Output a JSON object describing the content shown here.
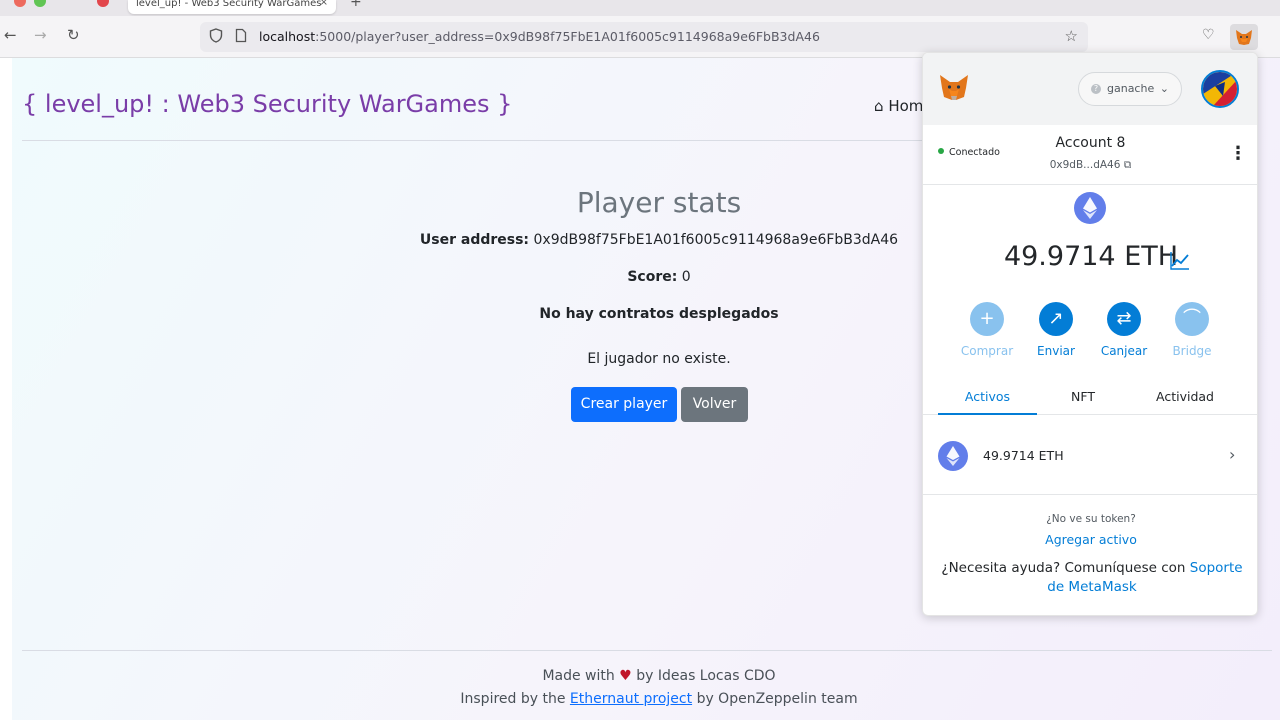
{
  "browser": {
    "tab_title": "level_up! - Web3 Security WarGames",
    "tab_close": "×",
    "new_tab": "+",
    "back_icon": "←",
    "forward_icon": "→",
    "reload_icon": "↻",
    "url_host": "localhost",
    "url_rest": ":5000/player?user_address=0x9dB98f75FbE1A01f6005c9114968a9e6FbB3dA46",
    "bookmark_icon": "☆",
    "pocket_icon": "♡"
  },
  "site": {
    "brand": "{ level_up! : Web3 Security WarGames }",
    "nav_home": "Hom",
    "home_icon": "⌂"
  },
  "player": {
    "title": "Player stats",
    "address_label": "User address:",
    "address_value": "0x9dB98f75FbE1A01f6005c9114968a9e6FbB3dA46",
    "score_label": "Score:",
    "score_value": "0",
    "no_contracts": "No hay contratos desplegados",
    "no_player": "El jugador no existe.",
    "create_button": "Crear player",
    "back_button": "Volver"
  },
  "footer": {
    "made_with_prefix": "Made with",
    "heart": "♥",
    "made_with_suffix": "by Ideas Locas CDO",
    "inspired_prefix": "Inspired by the",
    "ethernaut_link": "Ethernaut project",
    "inspired_suffix": "by OpenZeppelin team"
  },
  "metamask": {
    "network": "ganache",
    "network_q": "?",
    "network_chevron": "⌄",
    "connected": "Conectado",
    "account_name": "Account 8",
    "account_addr": "0x9dB...dA46",
    "copy_icon": "⧉",
    "kebab": "⋮",
    "balance": "49.9714 ETH",
    "actions": [
      {
        "label": "Comprar",
        "icon": "+",
        "color": "#89c2ee",
        "enabled": false
      },
      {
        "label": "Enviar",
        "icon": "↗",
        "color": "#037dd6",
        "enabled": true
      },
      {
        "label": "Canjear",
        "icon": "⇄",
        "color": "#037dd6",
        "enabled": true
      },
      {
        "label": "Bridge",
        "icon": "⌒",
        "color": "#89c2ee",
        "enabled": false
      }
    ],
    "tabs": [
      "Activos",
      "NFT",
      "Actividad"
    ],
    "asset_balance": "49.9714 ETH",
    "asset_chevron": "›",
    "no_token": "¿No ve su token?",
    "add_asset": "Agregar activo",
    "help_prefix": "¿Necesita ayuda? Comuníquese con",
    "help_link": "Soporte de MetaMask"
  }
}
